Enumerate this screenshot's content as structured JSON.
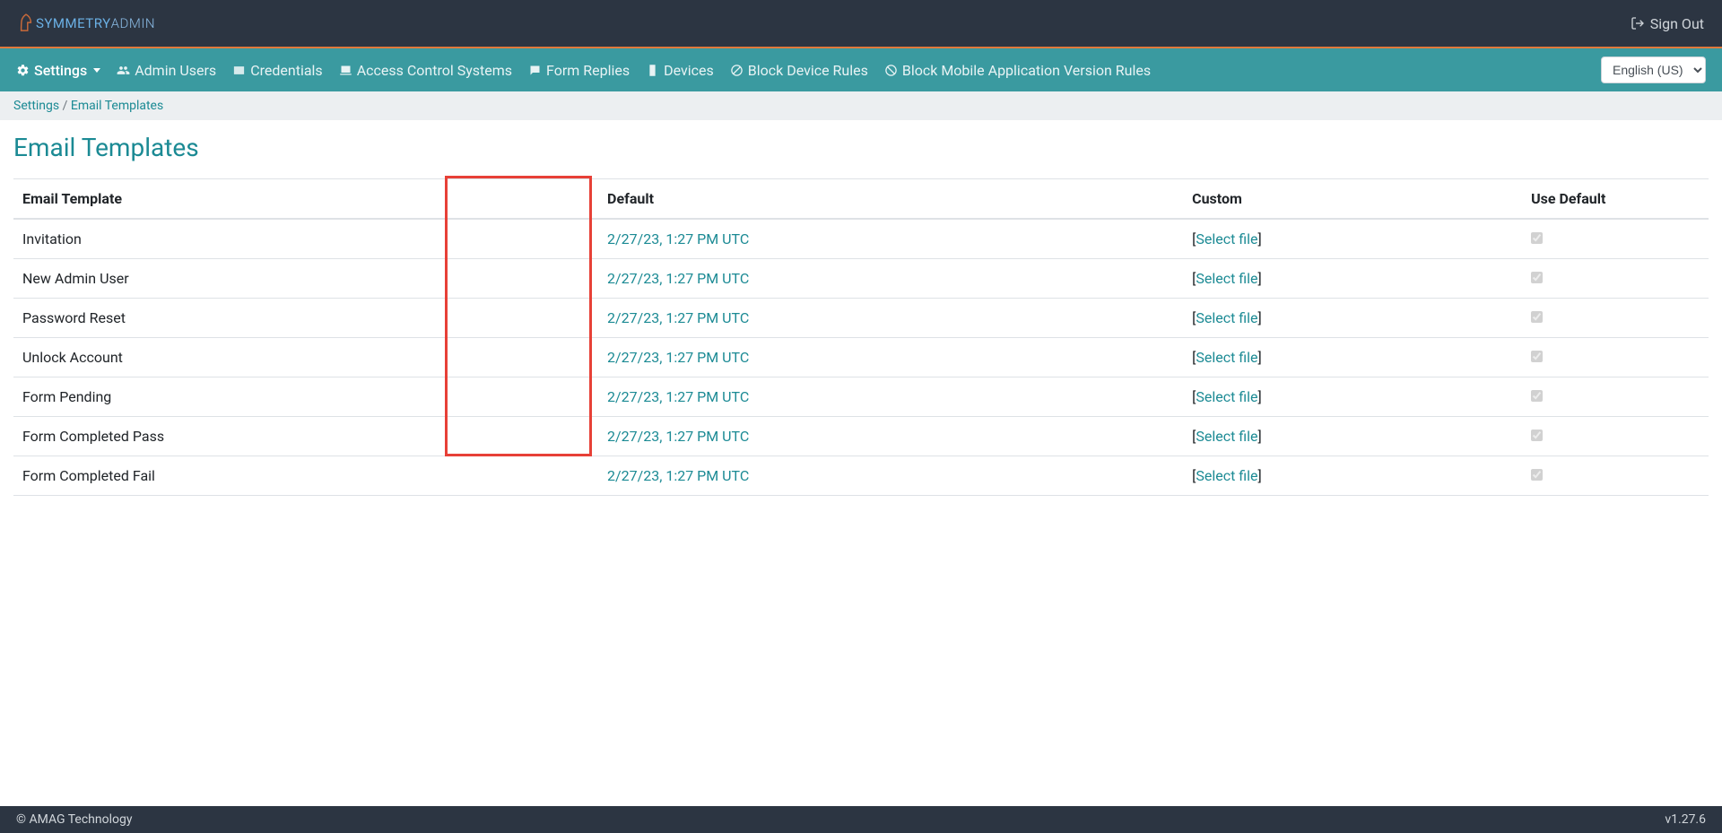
{
  "header": {
    "brand_part1": "SYMMETRY",
    "brand_part2": "ADMIN",
    "signout": "Sign Out"
  },
  "nav": {
    "settings": "Settings",
    "admin_users": "Admin Users",
    "credentials": "Credentials",
    "acs": "Access Control Systems",
    "form_replies": "Form Replies",
    "devices": "Devices",
    "block_device": "Block Device Rules",
    "block_mobile": "Block Mobile Application Version Rules",
    "language": "English (US)"
  },
  "breadcrumb": {
    "root": "Settings",
    "sep": " / ",
    "current": "Email Templates"
  },
  "page": {
    "title": "Email Templates"
  },
  "table": {
    "headers": {
      "template": "Email Template",
      "default": "Default",
      "custom": "Custom",
      "use_default": "Use Default"
    },
    "select_file": "Select file",
    "rows": [
      {
        "name": "Invitation",
        "default": "2/27/23, 1:27 PM UTC"
      },
      {
        "name": "New Admin User",
        "default": "2/27/23, 1:27 PM UTC"
      },
      {
        "name": "Password Reset",
        "default": "2/27/23, 1:27 PM UTC"
      },
      {
        "name": "Unlock Account",
        "default": "2/27/23, 1:27 PM UTC"
      },
      {
        "name": "Form Pending",
        "default": "2/27/23, 1:27 PM UTC"
      },
      {
        "name": "Form Completed Pass",
        "default": "2/27/23, 1:27 PM UTC"
      },
      {
        "name": "Form Completed Fail",
        "default": "2/27/23, 1:27 PM UTC"
      }
    ]
  },
  "footer": {
    "copyright": "© AMAG Technology",
    "version": "v1.27.6"
  }
}
